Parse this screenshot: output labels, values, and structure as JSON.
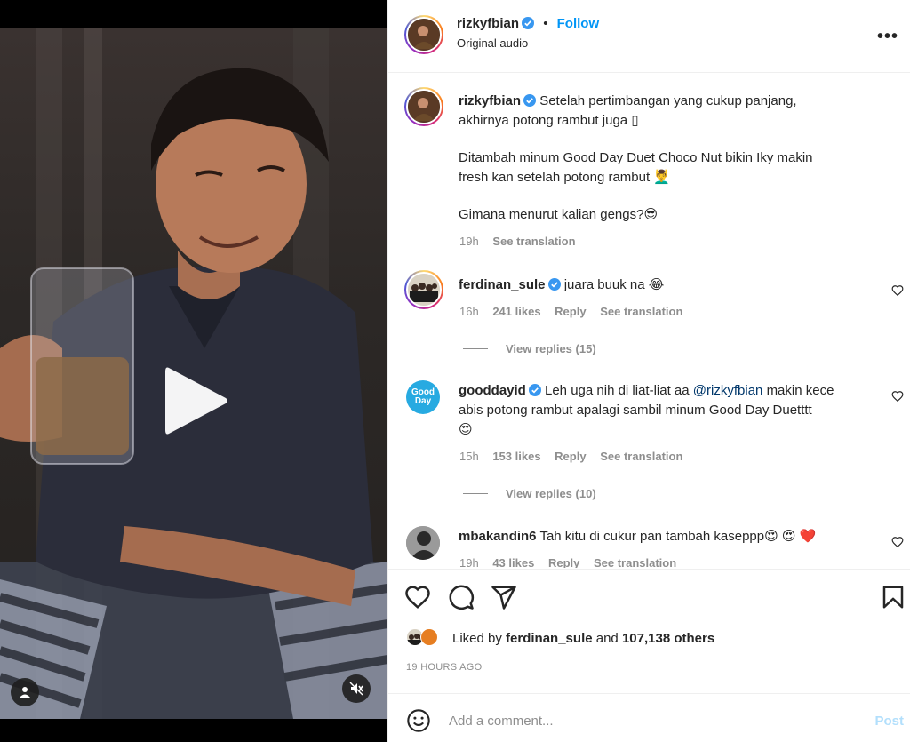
{
  "post": {
    "author": "rizkyfbian",
    "follow_label": "Follow",
    "separator": "•",
    "audio": "Original audio",
    "caption_line1": "Setelah pertimbangan yang cukup panjang,",
    "caption_line2": "akhirnya potong rambut juga ▯",
    "caption_para2_line1": "Ditambah minum Good Day Duet Choco Nut bikin Iky makin",
    "caption_para2_line2": "fresh kan setelah potong rambut",
    "caption_para2_emoji": "💆‍♂️",
    "caption_para3": "Gimana menurut kalian gengs?",
    "caption_para3_emoji": "😎",
    "caption_age": "19h",
    "see_translation": "See translation"
  },
  "comments": [
    {
      "user": "ferdinan_sule",
      "text": "juara buuk na",
      "emoji": "😂",
      "age": "16h",
      "likes": "241 likes",
      "reply": "Reply",
      "translate": "See translation",
      "view_replies": "View replies (15)"
    },
    {
      "user": "gooddayid",
      "avatar_text": "Good Day",
      "text_pre": "Leh uga nih di liat-liat aa",
      "mention": "@rizkyfbian",
      "text_post": "makin kece",
      "text_line2": "abis potong rambut apalagi sambil minum Good Day Duetttt",
      "emoji": "😍",
      "age": "15h",
      "likes": "153 likes",
      "reply": "Reply",
      "translate": "See translation",
      "view_replies": "View replies (10)"
    },
    {
      "user": "mbakandin6",
      "text": "Tah kitu di cukur pan tambah kaseppp",
      "emoji": "😍 😍 ❤️",
      "age": "19h",
      "likes": "43 likes",
      "reply": "Reply",
      "translate": "See translation"
    }
  ],
  "likes": {
    "prefix": "Liked by",
    "user": "ferdinan_sule",
    "and": "and",
    "others": "107,138 others"
  },
  "timestamp": "19 HOURS AGO",
  "composer": {
    "placeholder": "Add a comment...",
    "post_label": "Post"
  },
  "icons": {
    "more": "more-options-icon",
    "like": "heart-icon",
    "comment": "comment-icon",
    "share": "share-icon",
    "save": "bookmark-icon",
    "emoji": "emoji-icon",
    "play": "play-icon",
    "mute": "muted-icon",
    "tag": "user-tag-icon"
  },
  "colors": {
    "accent": "#0095f6",
    "post_disabled": "#b2dffc",
    "muted_text": "#8e8e8e",
    "mention": "#00376b",
    "verified": "#3897f0"
  }
}
